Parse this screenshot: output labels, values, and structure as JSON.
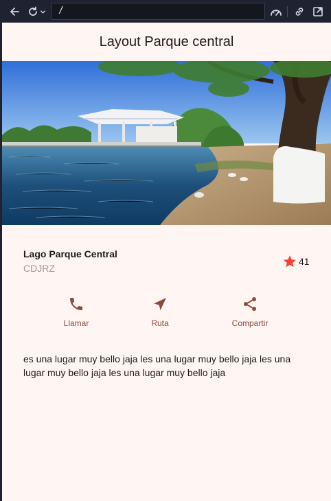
{
  "browser": {
    "url": "/",
    "icons": [
      "arrow-left-icon",
      "reload-icon",
      "chevron-down-icon",
      "gauge-icon",
      "link-icon",
      "external-link-icon"
    ]
  },
  "app": {
    "title": "Layout Parque central",
    "place": {
      "name": "Lago Parque Central",
      "subtitle": "CDJRZ",
      "rating": "41"
    },
    "actions": [
      {
        "label": "Llamar",
        "icon": "phone-icon"
      },
      {
        "label": "Ruta",
        "icon": "navigation-icon"
      },
      {
        "label": "Compartir",
        "icon": "share-icon"
      }
    ],
    "description": "es una lugar muy bello jaja les una lugar muy bello jaja les una lugar muy bello jaja les una lugar muy bello jaja",
    "colors": {
      "accent": "#8f4b3a",
      "star": "#f44336",
      "background": "#fff5f3"
    }
  }
}
